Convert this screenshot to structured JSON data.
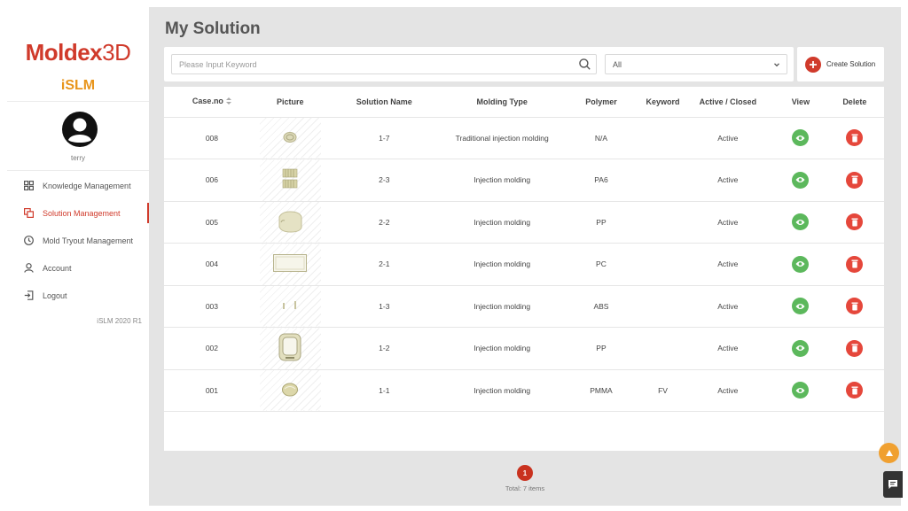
{
  "brand": {
    "logo_main": "Moldex",
    "logo_suffix": "3D",
    "subbrand": "iSLM"
  },
  "user": {
    "name": "terry"
  },
  "sidebar": {
    "items": [
      {
        "label": "Knowledge Management",
        "icon": "grid-icon",
        "active": false
      },
      {
        "label": "Solution Management",
        "icon": "copy-icon",
        "active": true
      },
      {
        "label": "Mold Tryout Management",
        "icon": "clock-icon",
        "active": false
      },
      {
        "label": "Account",
        "icon": "user-icon",
        "active": false
      },
      {
        "label": "Logout",
        "icon": "logout-icon",
        "active": false
      }
    ],
    "version": "iSLM 2020 R1"
  },
  "main": {
    "title": "My Solution",
    "search": {
      "placeholder": "Please Input Keyword",
      "value": ""
    },
    "filter": {
      "selected": "All"
    },
    "create_label": "Create Solution",
    "table": {
      "headers": [
        "Case.no",
        "Picture",
        "Solution Name",
        "Molding Type",
        "Polymer",
        "Keyword",
        "Active / Closed",
        "View",
        "Delete"
      ],
      "rows": [
        {
          "case_no": "008",
          "picture": "part-008",
          "name": "1-7",
          "type": "Traditional injection molding",
          "polymer": "N/A",
          "keyword": "",
          "status": "Active"
        },
        {
          "case_no": "006",
          "picture": "part-006",
          "name": "2-3",
          "type": "Injection molding",
          "polymer": "PA6",
          "keyword": "",
          "status": "Active"
        },
        {
          "case_no": "005",
          "picture": "part-005",
          "name": "2-2",
          "type": "Injection molding",
          "polymer": "PP",
          "keyword": "",
          "status": "Active"
        },
        {
          "case_no": "004",
          "picture": "part-004",
          "name": "2-1",
          "type": "Injection molding",
          "polymer": "PC",
          "keyword": "",
          "status": "Active"
        },
        {
          "case_no": "003",
          "picture": "part-003",
          "name": "1-3",
          "type": "Injection molding",
          "polymer": "ABS",
          "keyword": "",
          "status": "Active"
        },
        {
          "case_no": "002",
          "picture": "part-002",
          "name": "1-2",
          "type": "Injection molding",
          "polymer": "PP",
          "keyword": "",
          "status": "Active"
        },
        {
          "case_no": "001",
          "picture": "part-001",
          "name": "1-1",
          "type": "Injection molding",
          "polymer": "PMMA",
          "keyword": "FV",
          "status": "Active"
        }
      ]
    },
    "pagination": {
      "current": "1",
      "total_text": "Total: 7 items"
    }
  },
  "colors": {
    "brand_red": "#d03a2b",
    "brand_orange": "#e8951c",
    "view_green": "#5cb85c",
    "delete_red": "#e5473b"
  }
}
